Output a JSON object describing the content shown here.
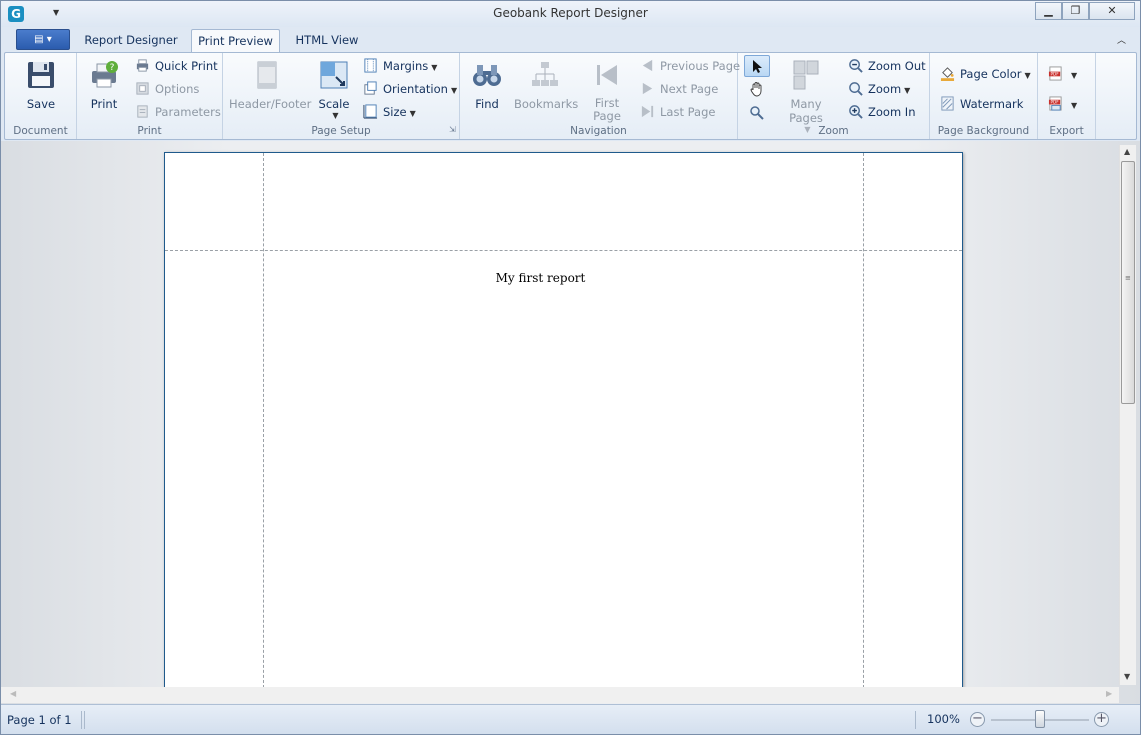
{
  "window": {
    "title": "Geobank Report Designer",
    "logo_letter": "G"
  },
  "tabs": [
    {
      "label": "Report Designer"
    },
    {
      "label": "Print Preview"
    },
    {
      "label": "HTML View"
    }
  ],
  "ribbon": {
    "document": {
      "label": "Document",
      "save": "Save"
    },
    "print": {
      "label": "Print",
      "print": "Print",
      "quick_print": "Quick Print",
      "options": "Options",
      "parameters": "Parameters"
    },
    "page_setup": {
      "label": "Page Setup",
      "header_footer": "Header/Footer",
      "scale": "Scale",
      "margins": "Margins",
      "orientation": "Orientation",
      "size": "Size"
    },
    "navigation": {
      "label": "Navigation",
      "find": "Find",
      "bookmarks": "Bookmarks",
      "first_page_1": "First",
      "first_page_2": "Page",
      "previous_page": "Previous Page",
      "next_page": "Next  Page",
      "last_page": "Last  Page"
    },
    "zoom": {
      "label": "Zoom",
      "many_pages": "Many Pages",
      "zoom_out": "Zoom Out",
      "zoom": "Zoom",
      "zoom_in": "Zoom In"
    },
    "page_background": {
      "label": "Page Background",
      "page_color": "Page Color",
      "watermark": "Watermark"
    },
    "export": {
      "label": "Export"
    }
  },
  "report": {
    "text": "My first report"
  },
  "status": {
    "page": "Page 1 of 1",
    "zoom": "100%",
    "zoom_fraction": 0.5
  },
  "colors": {
    "accent": "#2b5cae",
    "ribbon_bg": "#e5edf6",
    "page_border": "#1f5a8c"
  }
}
